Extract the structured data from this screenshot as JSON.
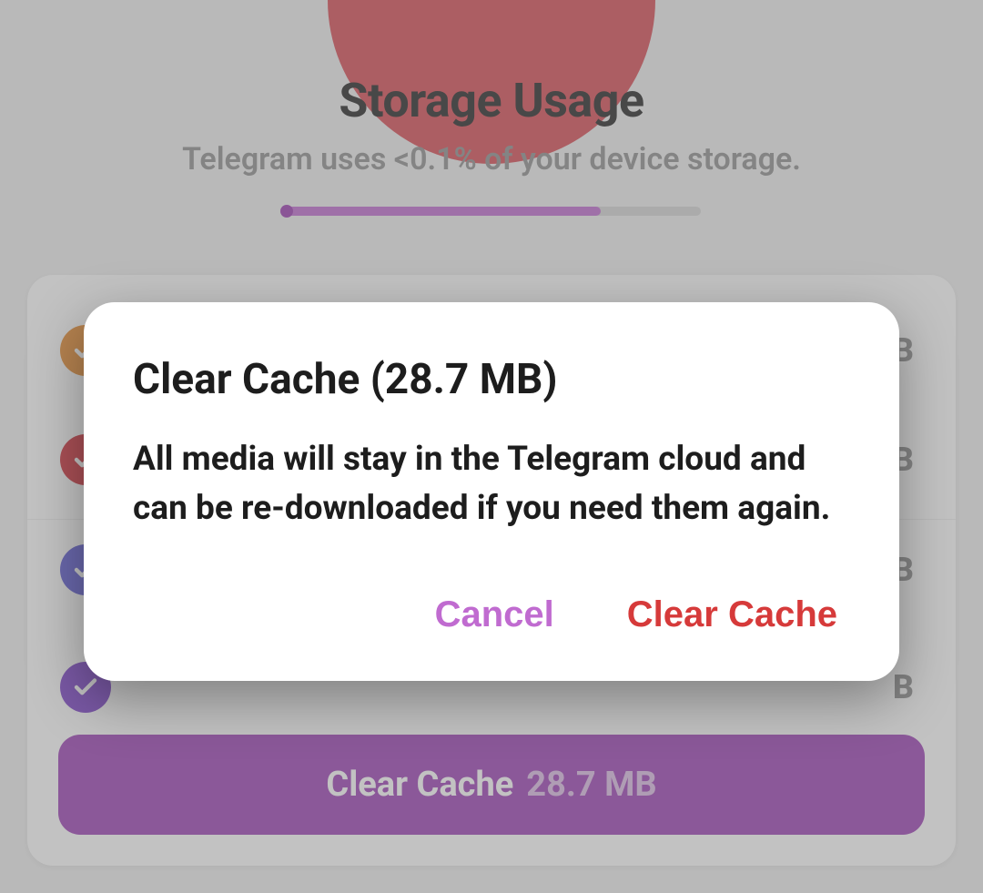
{
  "header": {
    "title": "Storage Usage",
    "subtitle": "Telegram uses <0.1% of your device storage."
  },
  "rows": {
    "r1_suffix": "B",
    "r2_suffix": "B",
    "r3_suffix": "B",
    "r4_suffix": "B"
  },
  "clear_button": {
    "label": "Clear Cache",
    "size": "28.7 MB"
  },
  "dialog": {
    "title": "Clear Cache (28.7 MB)",
    "body": "All media will stay in the Telegram cloud and can be re-downloaded if you need them again.",
    "cancel": "Cancel",
    "confirm": "Clear Cache"
  },
  "colors": {
    "accent_purple": "#9c3fb5",
    "accent_light_purple": "#c06bd0",
    "danger": "#d63a3a"
  }
}
